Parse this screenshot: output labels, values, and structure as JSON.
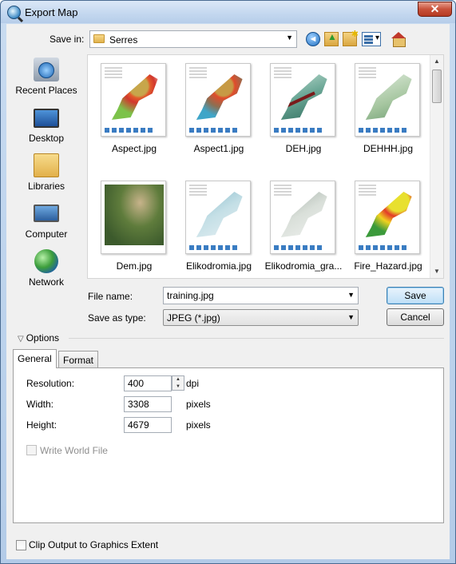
{
  "window": {
    "title": "Export Map",
    "close_label": "✕"
  },
  "toolbar": {
    "save_in_label": "Save in:",
    "save_in_value": "Serres",
    "buttons": [
      {
        "name": "back",
        "icon": "back-arrow-icon"
      },
      {
        "name": "up-one-level",
        "icon": "up-folder-icon"
      },
      {
        "name": "new-folder",
        "icon": "new-folder-icon"
      },
      {
        "name": "views-menu",
        "icon": "views-icon"
      },
      {
        "name": "home",
        "icon": "home-icon"
      }
    ]
  },
  "places": [
    {
      "label": "Recent Places",
      "icon": "recent-places-icon"
    },
    {
      "label": "Desktop",
      "icon": "desktop-icon"
    },
    {
      "label": "Libraries",
      "icon": "libraries-icon"
    },
    {
      "label": "Computer",
      "icon": "computer-icon"
    },
    {
      "label": "Network",
      "icon": "network-icon"
    }
  ],
  "files": [
    {
      "name": "Aspect.jpg",
      "style": "aspect"
    },
    {
      "name": "Aspect1.jpg",
      "style": "aspect1"
    },
    {
      "name": "DEH.jpg",
      "style": "deh"
    },
    {
      "name": "DEHHH.jpg",
      "style": "dehhh"
    },
    {
      "name": "Dem.jpg",
      "style": "dem"
    },
    {
      "name": "Elikodromia.jpg",
      "style": "elik"
    },
    {
      "name": "Elikodromia_gra...",
      "style": "elikgra"
    },
    {
      "name": "Fire_Hazard.jpg",
      "style": "fire"
    }
  ],
  "form": {
    "file_name_label": "File name:",
    "file_name_value": "training.jpg",
    "save_as_type_label": "Save as type:",
    "save_as_type_value": "JPEG (*.jpg)",
    "save_button": "Save",
    "cancel_button": "Cancel"
  },
  "options": {
    "toggle_label": "Options",
    "tabs": [
      {
        "label": "General",
        "active": true
      },
      {
        "label": "Format",
        "active": false
      }
    ],
    "resolution": {
      "label": "Resolution:",
      "value": "400",
      "unit": "dpi"
    },
    "width": {
      "label": "Width:",
      "value": "3308",
      "unit": "pixels"
    },
    "height": {
      "label": "Height:",
      "value": "4679",
      "unit": "pixels"
    },
    "write_world_file": {
      "label": "Write World File",
      "checked": false,
      "enabled": false
    }
  },
  "clip_output": {
    "label": "Clip Output to Graphics Extent",
    "checked": false
  }
}
